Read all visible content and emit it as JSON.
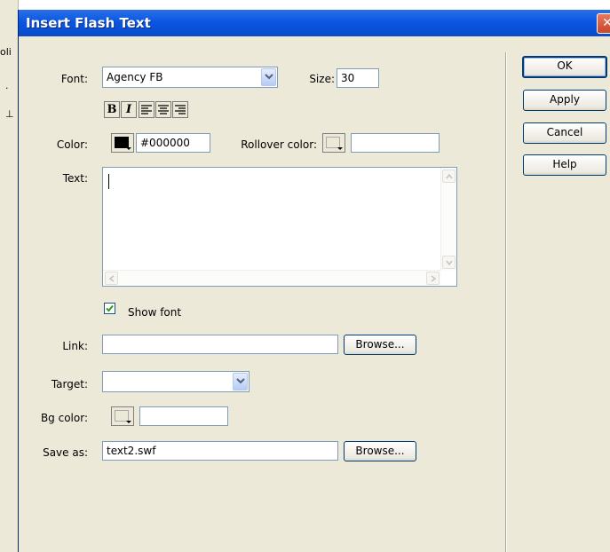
{
  "background": {
    "fragments": [
      "oli",
      "·",
      "⊥"
    ]
  },
  "dialog": {
    "title": "Insert Flash Text",
    "close_glyph": "✕"
  },
  "form": {
    "font_label": "Font:",
    "font_value": "Agency FB",
    "size_label": "Size:",
    "size_value": "30",
    "format_buttons": {
      "bold": "B",
      "italic": "I"
    },
    "color_label": "Color:",
    "color_value": "#000000",
    "rollover_label": "Rollover color:",
    "rollover_value": "",
    "text_label": "Text:",
    "text_value": "",
    "show_font_label": "Show font",
    "show_font_checked": true,
    "link_label": "Link:",
    "link_value": "",
    "link_browse": "Browse...",
    "target_label": "Target:",
    "target_value": "",
    "bgcolor_label": "Bg color:",
    "bgcolor_value": "",
    "saveas_label": "Save as:",
    "saveas_value": "text2.swf",
    "saveas_browse": "Browse..."
  },
  "buttons": {
    "ok": "OK",
    "apply": "Apply",
    "cancel": "Cancel",
    "help": "Help"
  },
  "colors": {
    "title_bar": "#0a56e0",
    "dialog_bg": "#ece9d8",
    "field_border": "#7f9db9",
    "text_color_swatch": "#000000"
  }
}
